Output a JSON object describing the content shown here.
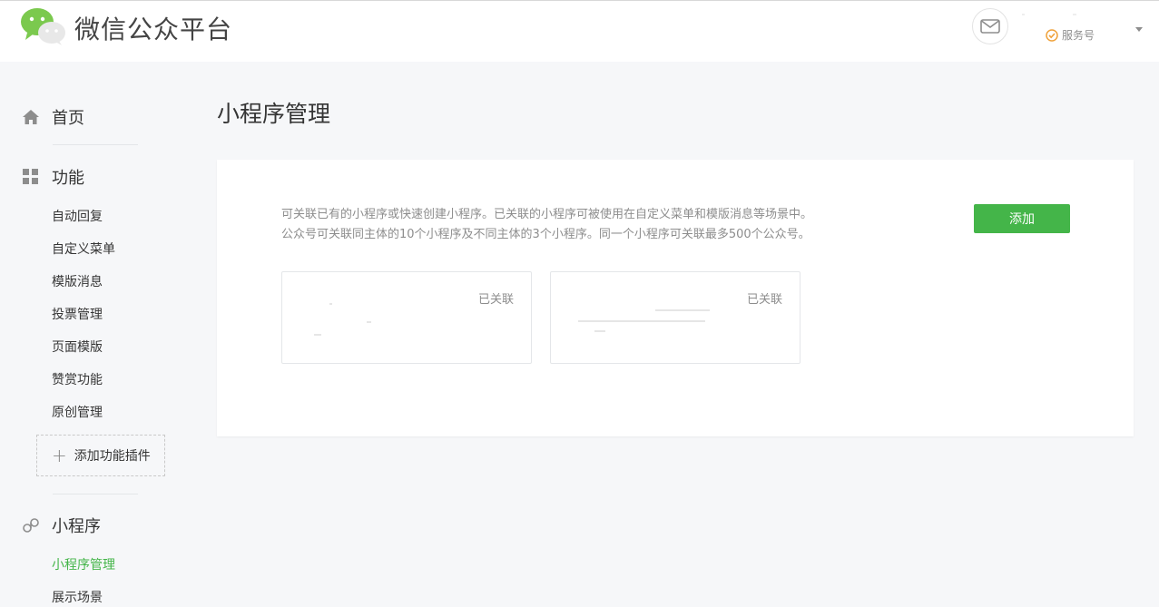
{
  "header": {
    "brand": "微信公众平台",
    "account_type": "服务号"
  },
  "sidebar": {
    "home": "首页",
    "features": "功能",
    "feature_items": [
      "自动回复",
      "自定义菜单",
      "模版消息",
      "投票管理",
      "页面模版",
      "赞赏功能",
      "原创管理"
    ],
    "add_plugin": "添加功能插件",
    "miniprogram": "小程序",
    "miniprogram_items": [
      "小程序管理",
      "展示场景"
    ]
  },
  "main": {
    "title": "小程序管理",
    "desc_line1": "可关联已有的小程序或快速创建小程序。已关联的小程序可被使用在自定义菜单和模版消息等场景中。",
    "desc_line2": "公众号可关联同主体的10个小程序及不同主体的3个小程序。同一个小程序可关联最多500个公众号。",
    "add_button": "添加",
    "cards": [
      {
        "status": "已关联"
      },
      {
        "status": "已关联"
      }
    ]
  },
  "colors": {
    "accent": "#44b549",
    "background": "#f6f7f9"
  }
}
